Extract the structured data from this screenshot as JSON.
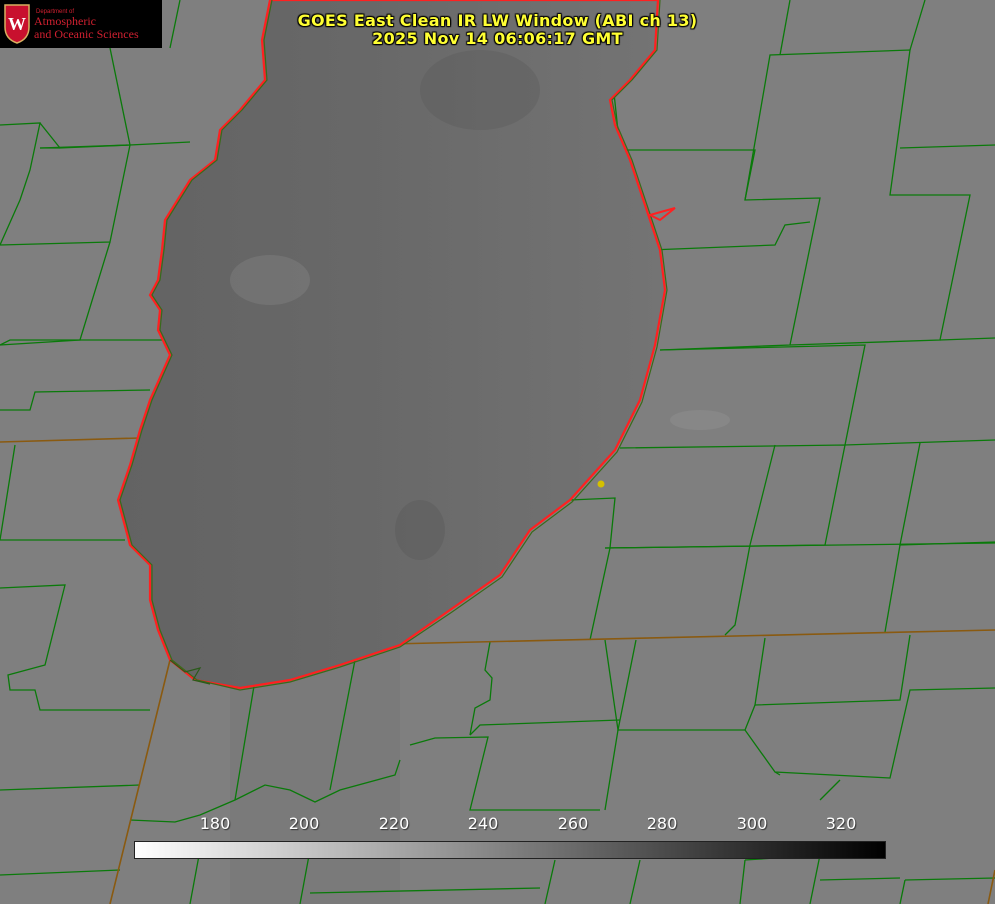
{
  "title": {
    "line1": "GOES East Clean IR LW Window (ABI ch 13)",
    "line2": "2025 Nov 14 06:06:17 GMT"
  },
  "logo": {
    "small": "Department of",
    "line1": "Atmospheric",
    "line2": "and Oceanic Sciences",
    "crest_letter": "W",
    "color": "#c8102e"
  },
  "colorbar": {
    "ticks": [
      "180",
      "200",
      "220",
      "240",
      "260",
      "280",
      "300",
      "320"
    ],
    "min": 162,
    "max": 330,
    "gradient": [
      "#ffffff",
      "#000000"
    ]
  },
  "colors": {
    "county_lines": "#008000",
    "lake_outline": "#ff2020",
    "land_gray": "#808080",
    "lake_gray": "#6a6a6a",
    "marker": "#d4c000"
  }
}
